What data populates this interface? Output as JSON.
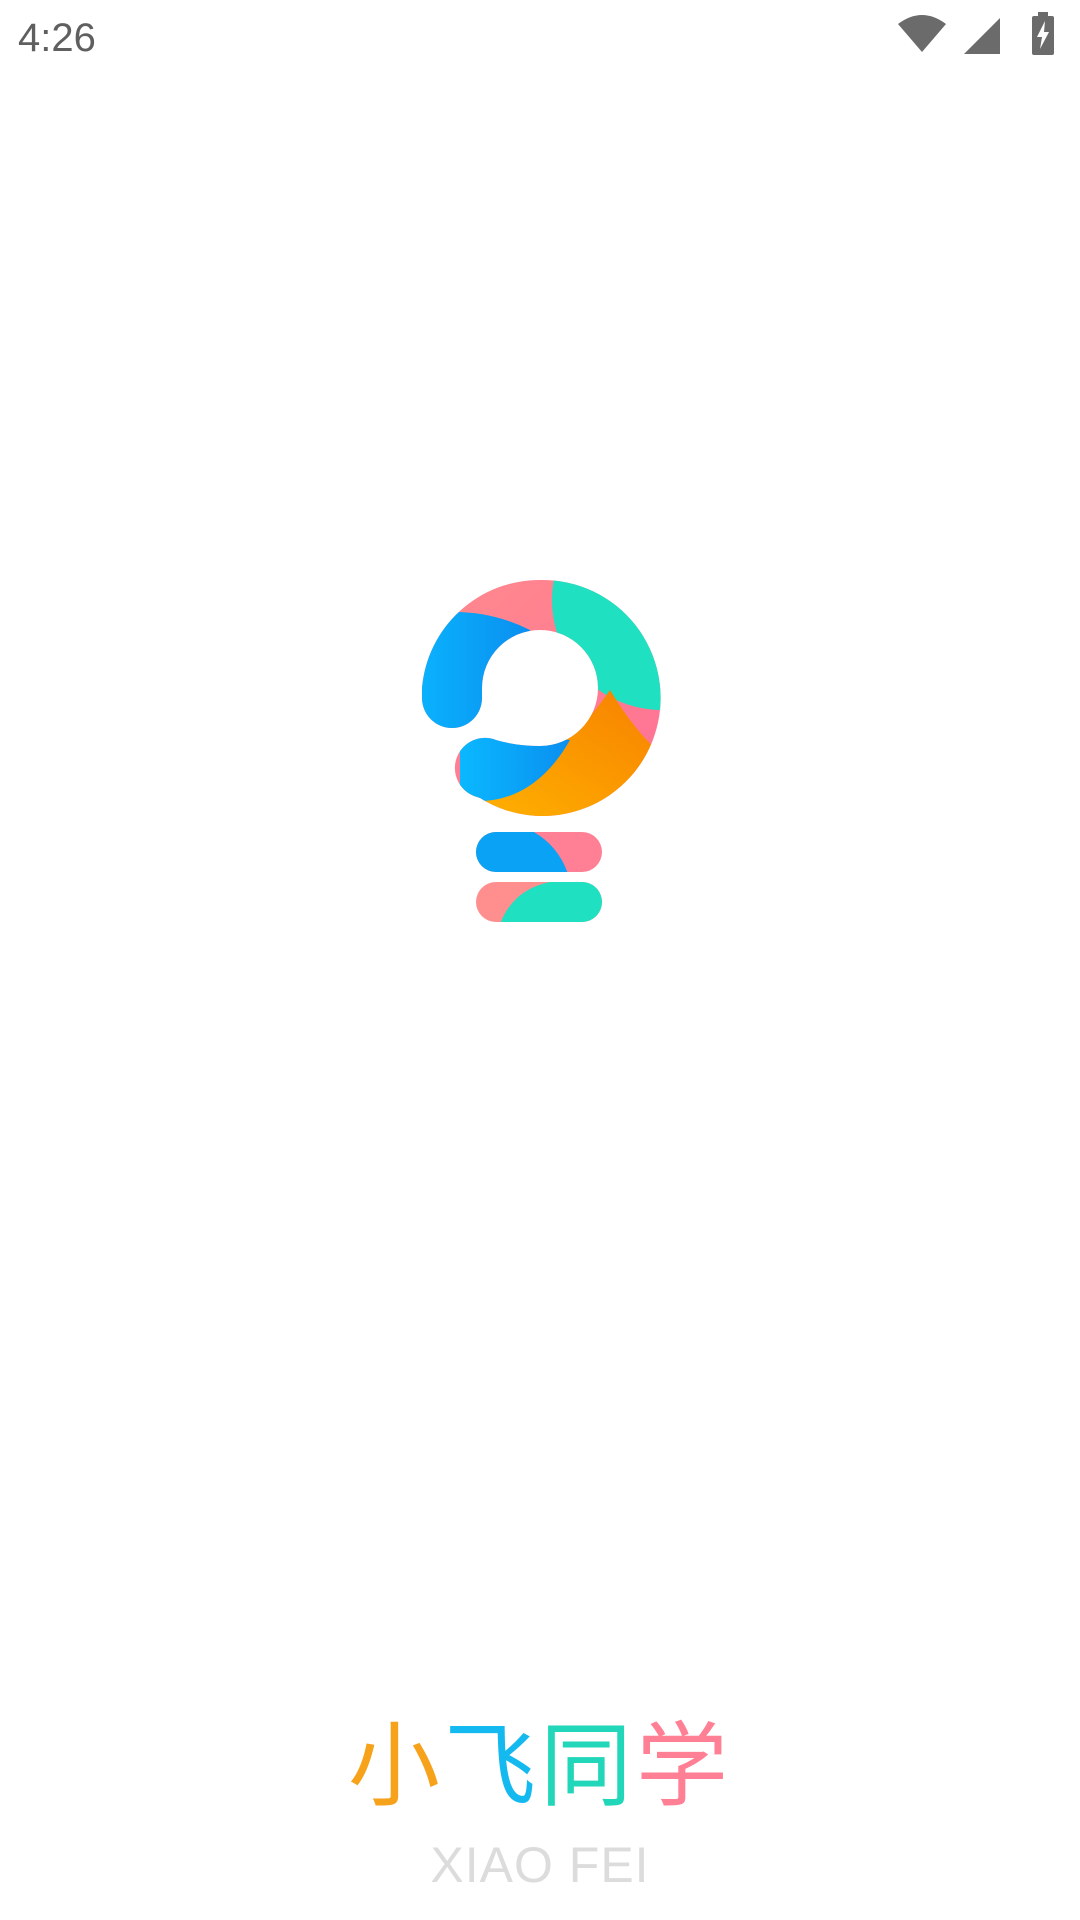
{
  "status_bar": {
    "time": "4:26",
    "icons": [
      "wifi-icon",
      "cellular-signal-icon",
      "battery-charging-icon"
    ],
    "icon_color": "#6b6b6b"
  },
  "splash": {
    "logo_icon": "lightbulb-question-logo-icon",
    "brand_chars": [
      "小",
      "飞",
      "同",
      "学"
    ],
    "brand_char_colors": [
      "#f7a21b",
      "#14b9f0",
      "#22d6b9",
      "#ff7f94"
    ],
    "brand_en": "XIAO FEI"
  },
  "colors": {
    "logo_pink": "#ff7f94",
    "logo_blue": "#0aa2f5",
    "logo_teal": "#1fe0c0",
    "logo_orange": "#f7a21b",
    "background": "#ffffff",
    "subtitle": "#dcdcdc"
  }
}
